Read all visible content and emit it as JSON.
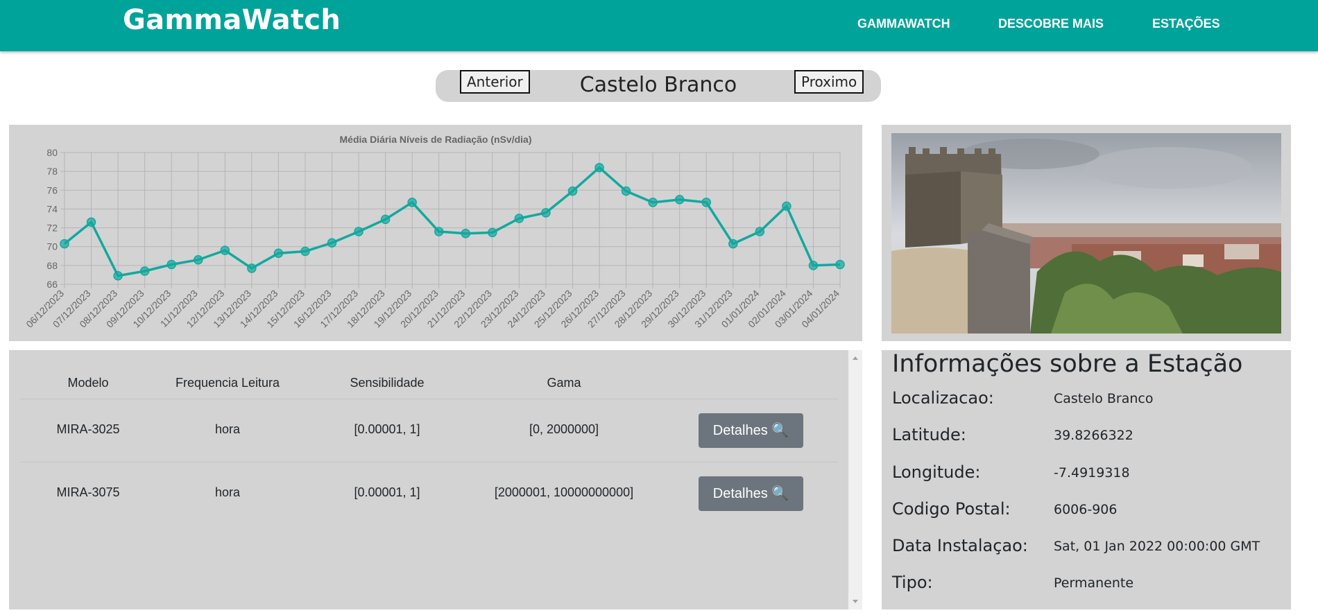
{
  "navbar": {
    "brand": "GammaWatch",
    "links": [
      "GAMMAWATCH",
      "DESCOBRE MAIS",
      "ESTAÇÕES"
    ],
    "color": "#00a39a"
  },
  "switcher": {
    "prev_label": "Anterior",
    "next_label": "Proximo",
    "station_name": "Castelo Branco"
  },
  "chart_data": {
    "type": "line",
    "title": "Média Diária Níveis de Radiação (nSv/dia)",
    "xlabel": "",
    "ylabel": "",
    "ylim": [
      66,
      80
    ],
    "yticks": [
      66,
      68,
      70,
      72,
      74,
      76,
      78,
      80
    ],
    "grid": true,
    "color": "#13a89e",
    "categories": [
      "06/12/2023",
      "07/12/2023",
      "08/12/2023",
      "09/12/2023",
      "10/12/2023",
      "11/12/2023",
      "12/12/2023",
      "13/12/2023",
      "14/12/2023",
      "15/12/2023",
      "16/12/2023",
      "17/12/2023",
      "18/12/2023",
      "19/12/2023",
      "20/12/2023",
      "21/12/2023",
      "22/12/2023",
      "23/12/2023",
      "24/12/2023",
      "25/12/2023",
      "26/12/2023",
      "27/12/2023",
      "28/12/2023",
      "29/12/2023",
      "30/12/2023",
      "31/12/2023",
      "01/01/2024",
      "02/01/2024",
      "03/01/2024",
      "04/01/2024"
    ],
    "values": [
      70.3,
      72.6,
      66.9,
      67.4,
      68.1,
      68.6,
      69.6,
      67.7,
      69.3,
      69.5,
      70.4,
      71.6,
      72.9,
      74.7,
      71.6,
      71.4,
      71.5,
      73.0,
      73.6,
      75.9,
      78.4,
      75.9,
      74.7,
      75.0,
      74.7,
      70.3,
      71.6,
      74.3,
      68.0,
      68.1
    ]
  },
  "table": {
    "headers": [
      "Modelo",
      "Frequencia Leitura",
      "Sensibilidade",
      "Gama"
    ],
    "rows": [
      {
        "modelo": "MIRA-3025",
        "frequencia": "hora",
        "sensibilidade": "[0.00001, 1]",
        "gama": "[0, 2000000]",
        "button": "Detalhes 🔍"
      },
      {
        "modelo": "MIRA-3075",
        "frequencia": "hora",
        "sensibilidade": "[0.00001, 1]",
        "gama": "[2000001, 10000000000]",
        "button": "Detalhes 🔍"
      }
    ]
  },
  "info": {
    "title": "Informações sobre a Estação",
    "fields": [
      {
        "key": "Localizacao:",
        "value": "Castelo Branco"
      },
      {
        "key": "Latitude:",
        "value": "39.8266322"
      },
      {
        "key": "Longitude:",
        "value": "-7.4919318"
      },
      {
        "key": "Codigo Postal:",
        "value": "6006-906"
      },
      {
        "key": "Data Instalaçao:",
        "value": "Sat, 01 Jan 2022 00:00:00 GMT"
      },
      {
        "key": "Tipo:",
        "value": "Permanente"
      }
    ]
  }
}
